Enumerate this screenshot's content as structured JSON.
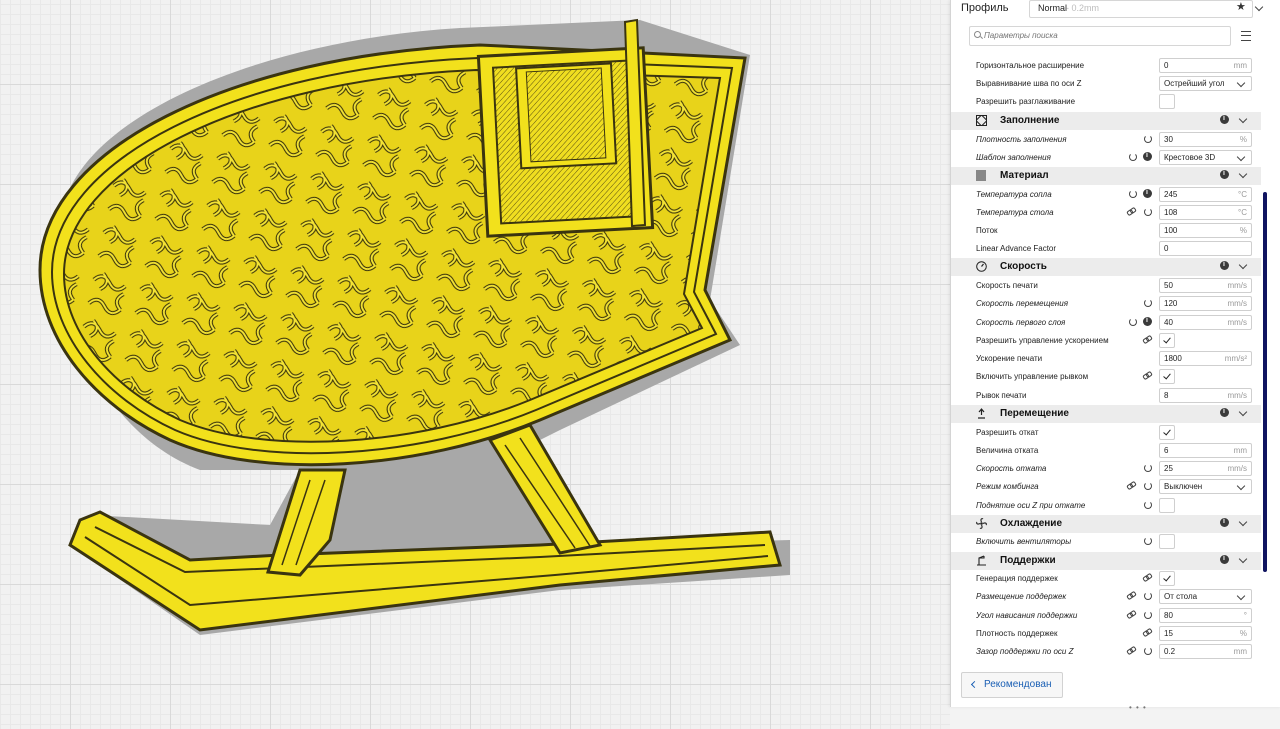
{
  "profile": {
    "label": "Профиль",
    "name": "Normal",
    "layer": "- 0.2mm"
  },
  "search": {
    "placeholder": "Параметры поиска"
  },
  "footer": {
    "back_label": "Рекомендован"
  },
  "settings": {
    "r1": {
      "label": "Горизонтальное расширение",
      "value": "0",
      "unit": "mm"
    },
    "r2": {
      "label": "Выравнивание шва по оси Z",
      "value": "Острейший угол"
    },
    "r3": {
      "label": "Разрешить разглаживание"
    },
    "c1": {
      "title": "Заполнение",
      "icon": "infill-icon"
    },
    "r4": {
      "label": "Плотность заполнения",
      "value": "30",
      "unit": "%"
    },
    "r5": {
      "label": "Шаблон заполнения",
      "value": "Крестовое 3D"
    },
    "c2": {
      "title": "Материал",
      "icon": "material-icon"
    },
    "r6": {
      "label": "Температура сопла",
      "value": "245",
      "unit": "°C"
    },
    "r7": {
      "label": "Температура стола",
      "value": "108",
      "unit": "°C"
    },
    "r8": {
      "label": "Поток",
      "value": "100",
      "unit": "%"
    },
    "r9": {
      "label": "Linear Advance Factor",
      "value": "0"
    },
    "c3": {
      "title": "Скорость",
      "icon": "speed-icon"
    },
    "r10": {
      "label": "Скорость печати",
      "value": "50",
      "unit": "mm/s"
    },
    "r11": {
      "label": "Скорость перемещения",
      "value": "120",
      "unit": "mm/s"
    },
    "r12": {
      "label": "Скорость первого слоя",
      "value": "40",
      "unit": "mm/s"
    },
    "r13": {
      "label": "Разрешить управление ускорением"
    },
    "r14": {
      "label": "Ускорение печати",
      "value": "1800",
      "unit": "mm/s²"
    },
    "r15": {
      "label": "Включить управление рывком"
    },
    "r16": {
      "label": "Рывок печати",
      "value": "8",
      "unit": "mm/s"
    },
    "c4": {
      "title": "Перемещение",
      "icon": "travel-icon"
    },
    "r17": {
      "label": "Разрешить откат"
    },
    "r18": {
      "label": "Величина отката",
      "value": "6",
      "unit": "mm"
    },
    "r19": {
      "label": "Скорость отката",
      "value": "25",
      "unit": "mm/s"
    },
    "r20": {
      "label": "Режим комбинга",
      "value": "Выключен"
    },
    "r21": {
      "label": "Поднятие оси Z при откате"
    },
    "c5": {
      "title": "Охлаждение",
      "icon": "fan-icon"
    },
    "r22": {
      "label": "Включить вентиляторы"
    },
    "c6": {
      "title": "Поддержки",
      "icon": "support-icon"
    },
    "r23": {
      "label": "Генерация поддержек"
    },
    "r24": {
      "label": "Размещение поддержек",
      "value": "От стола"
    },
    "r25": {
      "label": "Угол нависания поддержки",
      "value": "80",
      "unit": "°"
    },
    "r26": {
      "label": "Плотность поддержек",
      "value": "15",
      "unit": "%"
    },
    "r27": {
      "label": "Зазор поддержки по оси Z",
      "value": "0.2",
      "unit": "mm"
    }
  },
  "colors": {
    "model": "#f2e11c",
    "model_dark": "#3a3410",
    "shadow": "#a8a8a8",
    "accent": "#1a5fb4",
    "scrollbar": "#101460"
  }
}
